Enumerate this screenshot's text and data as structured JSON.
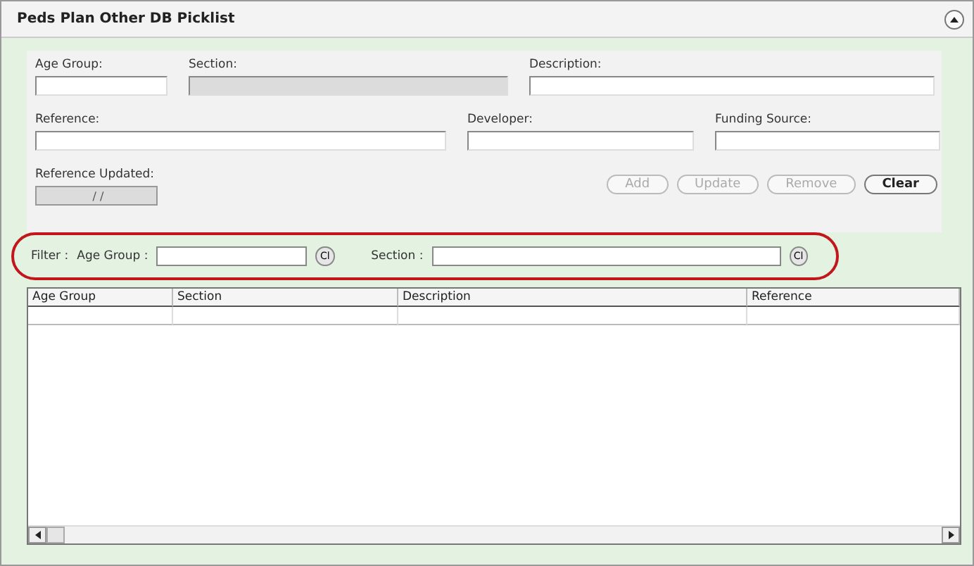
{
  "panel": {
    "title": "Peds Plan Other DB Picklist"
  },
  "form": {
    "rows": [
      [
        {
          "label": "Age Group:",
          "disabled": false
        },
        {
          "label": "Section:",
          "disabled": true
        },
        {
          "label": "Description:",
          "disabled": false
        }
      ],
      [
        {
          "label": "Reference:",
          "disabled": false
        },
        {
          "label": "Developer:",
          "disabled": false
        },
        {
          "label": "Funding Source:",
          "disabled": false
        }
      ]
    ],
    "reference_updated": {
      "label": "Reference Updated:",
      "value": " / /",
      "disabled": true
    },
    "buttons": [
      {
        "label": "Add",
        "disabled": true
      },
      {
        "label": "Update",
        "disabled": true
      },
      {
        "label": "Remove",
        "disabled": true
      },
      {
        "label": "Clear",
        "disabled": false
      }
    ]
  },
  "filter": {
    "label": "Filter :",
    "fields": [
      {
        "label": "Age Group :",
        "clear": "Cl"
      },
      {
        "label": "Section :",
        "clear": "Cl"
      }
    ]
  },
  "table": {
    "columns": [
      "Age Group",
      "Section",
      "Description",
      "Reference"
    ]
  }
}
